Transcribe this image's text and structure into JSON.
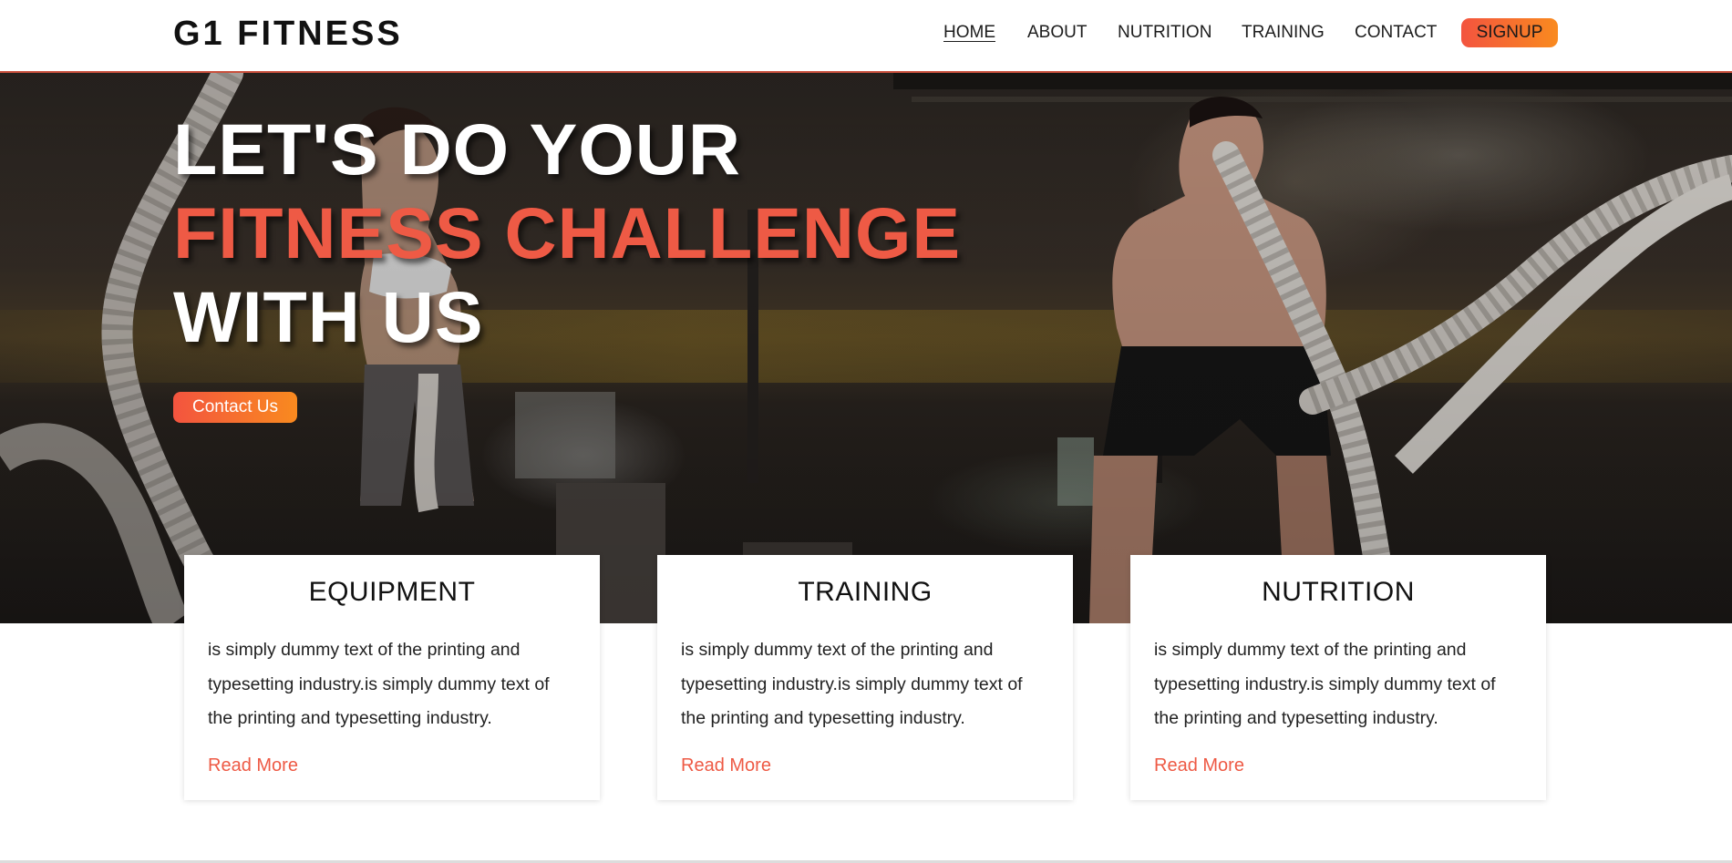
{
  "header": {
    "logo": "G1 FITNESS",
    "nav": [
      {
        "label": "HOME",
        "active": true
      },
      {
        "label": "ABOUT",
        "active": false
      },
      {
        "label": "NUTRITION",
        "active": false
      },
      {
        "label": "TRAINING",
        "active": false
      },
      {
        "label": "CONTACT",
        "active": false
      }
    ],
    "signup_label": "SIGNUP"
  },
  "hero": {
    "line1": "LET'S DO YOUR",
    "line2": "FITNESS CHALLENGE",
    "line3": "WITH US",
    "button_label": "Contact Us"
  },
  "cards": [
    {
      "title": "EQUIPMENT",
      "text": "is simply dummy text of the printing and typesetting industry.is simply dummy text of the printing and typesetting industry.",
      "link": "Read More"
    },
    {
      "title": "TRAINING",
      "text": "is simply dummy text of the printing and typesetting industry.is simply dummy text of the printing and typesetting industry.",
      "link": "Read More"
    },
    {
      "title": "NUTRITION",
      "text": "is simply dummy text of the printing and typesetting industry.is simply dummy text of the printing and typesetting industry.",
      "link": "Read More"
    }
  ],
  "colors": {
    "accent": "#ee5a45",
    "button_gradient_start": "#f3543f",
    "button_gradient_end": "#f98a1f",
    "header_border": "#c9503d"
  }
}
